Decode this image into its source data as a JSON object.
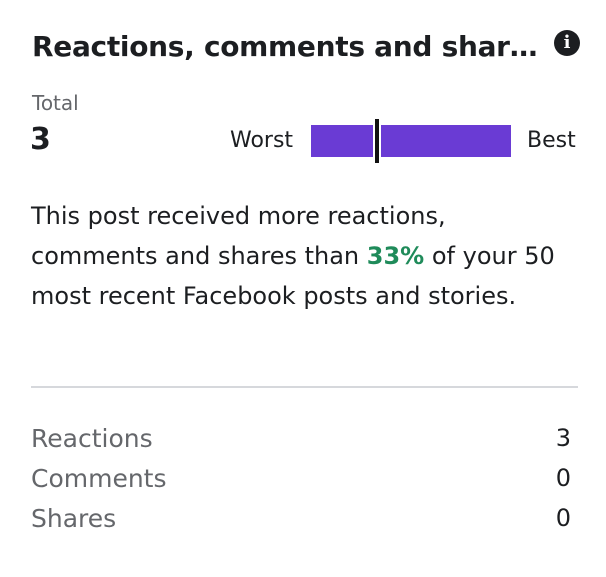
{
  "header": {
    "title": "Reactions, comments and shar…",
    "info_icon": "info-icon"
  },
  "total": {
    "label": "Total",
    "value": "3"
  },
  "scale": {
    "worst_label": "Worst",
    "best_label": "Best",
    "marker_position_fraction": 0.33,
    "bar_color": "#6a3bd4"
  },
  "description": {
    "before": "This post received more reactions, comments and shares than ",
    "highlight": "33%",
    "after": " of your 50 most recent Facebook posts and stories.",
    "highlight_color": "#1f8b5a"
  },
  "breakdown": [
    {
      "label": "Reactions",
      "value": "3"
    },
    {
      "label": "Comments",
      "value": "0"
    },
    {
      "label": "Shares",
      "value": "0"
    }
  ]
}
